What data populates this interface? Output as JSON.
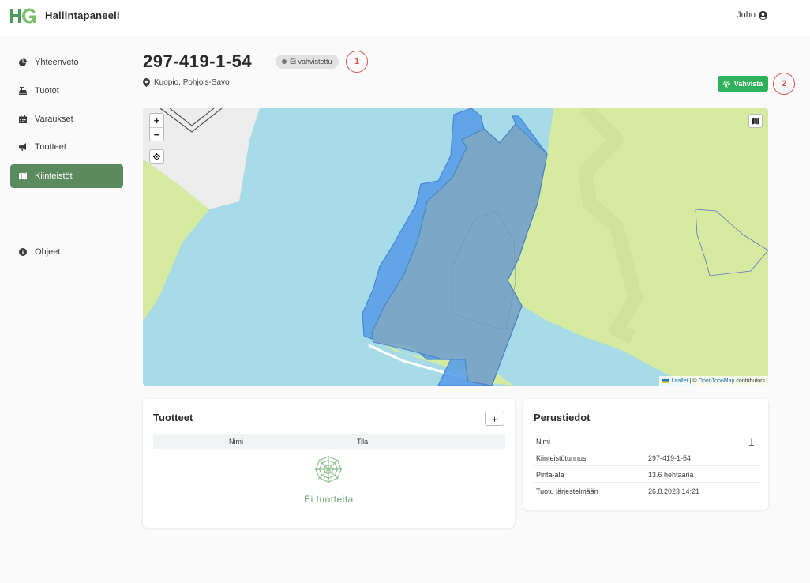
{
  "header": {
    "app_title": "Hallintapaneeli",
    "user_name": "Juho",
    "logo_icon": "hg-logo",
    "user_icon": "user-circle-icon"
  },
  "sidebar": {
    "items": [
      {
        "label": "Yhteenveto",
        "icon": "chart-pie-icon",
        "active": false
      },
      {
        "label": "Tuotot",
        "icon": "cash-register-icon",
        "active": false
      },
      {
        "label": "Varaukset",
        "icon": "calendar-icon",
        "active": false
      },
      {
        "label": "Tuotteet",
        "icon": "megaphone-icon",
        "active": false
      },
      {
        "label": "Kiinteistöt",
        "icon": "map-icon",
        "active": true
      },
      {
        "label": "Ohjeet",
        "icon": "info-circle-icon",
        "active": false
      }
    ]
  },
  "property": {
    "title": "297-419-1-54",
    "status": "Ei vahvistettu",
    "location": "Kuopio, Pohjois-Savo",
    "confirm_label": "Vahvista"
  },
  "markers": [
    "1",
    "2"
  ],
  "map": {
    "zoom_in": "+",
    "zoom_out": "−",
    "attribution_leaflet": "Leaflet",
    "attribution_sep": "| ©",
    "attribution_source": "OpenTopoMap",
    "attribution_suffix": "contributors"
  },
  "products": {
    "title": "Tuotteet",
    "add_label": "+",
    "columns": [
      "Nimi",
      "Tila"
    ],
    "empty_text": "Ei tuotteita",
    "empty_icon": "spider-web-icon"
  },
  "basic_info": {
    "title": "Perustiedot",
    "rows": [
      {
        "key": "Nimi",
        "value": "-"
      },
      {
        "key": "Kiinteistötunnus",
        "value": "297-419-1-54"
      },
      {
        "key": "Pinta-ala",
        "value": "13.6 hehtaaria"
      },
      {
        "key": "Tuotu järjestelmään",
        "value": "26.8.2023 14:21"
      }
    ]
  },
  "colors": {
    "accent": "#5a8a5e",
    "confirm": "#2fb15a",
    "marker": "#d9534f",
    "water": "#a6dbe7",
    "land": "#d6eba0",
    "parcel": "#3b8de0"
  }
}
